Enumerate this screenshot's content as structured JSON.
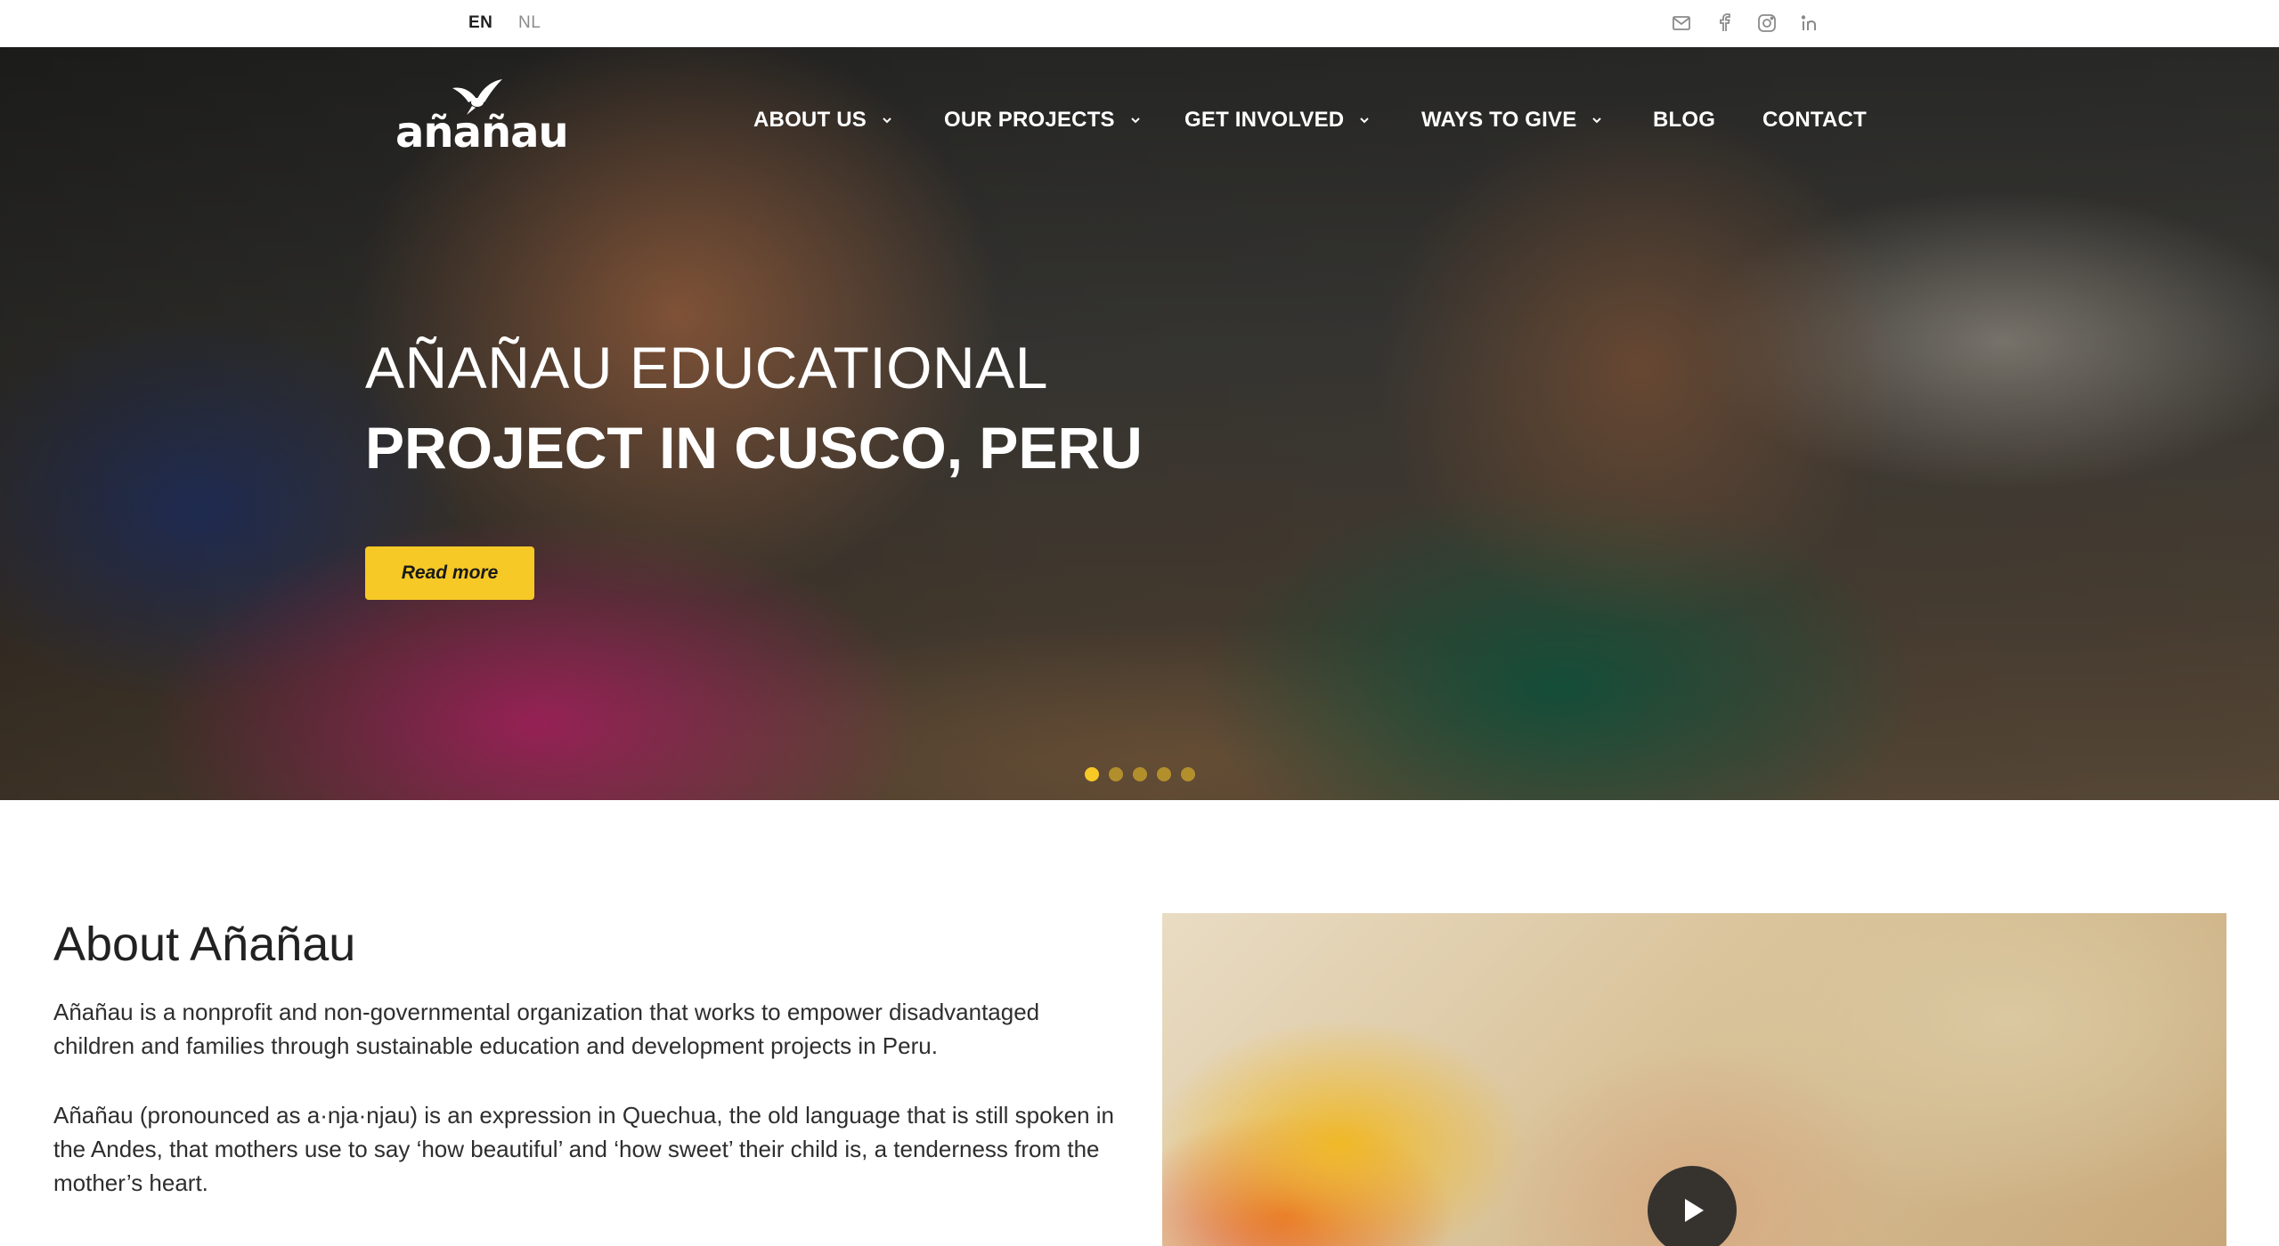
{
  "languages": {
    "en": "EN",
    "nl": "NL"
  },
  "social": [
    "mail-icon",
    "facebook-icon",
    "instagram-icon",
    "linkedin-icon"
  ],
  "logo": {
    "text": "añañau"
  },
  "nav": {
    "about": "ABOUT US",
    "projects": "OUR PROJECTS",
    "involved": "GET INVOLVED",
    "give": "WAYS TO GIVE",
    "blog": "BLOG",
    "contact": "CONTACT"
  },
  "hero": {
    "line1": "AÑAÑAU EDUCATIONAL",
    "line2": "PROJECT IN CUSCO, PERU",
    "cta": "Read more",
    "slides": 5,
    "active_slide": 1
  },
  "about": {
    "title": "About Añañau",
    "paragraphs": [
      "Añañau is a nonprofit and non-governmental organization that works to empower disadvantaged children and families through sustainable education and development projects in Peru.",
      "Añañau (pronounced as a·nja·njau) is an expression in Quechua, the old language that is still spoken in the Andes, that mothers use to say ‘how beautiful’ and ‘how sweet’ their child is, a tenderness from the mother’s heart."
    ]
  },
  "colors": {
    "accent": "#f6c927",
    "text": "#2b2b2b",
    "nav_text": "#ffffff"
  }
}
